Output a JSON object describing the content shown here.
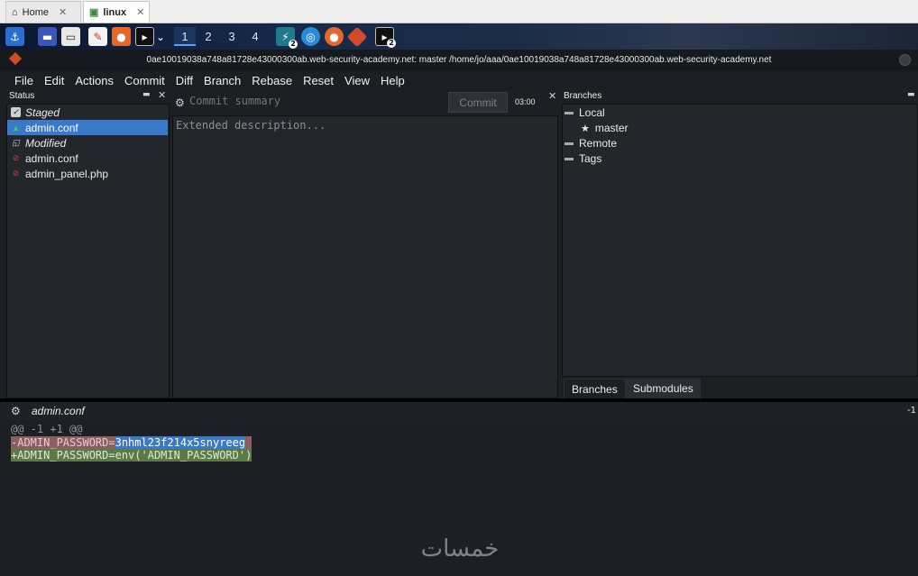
{
  "vm_tabs": [
    {
      "label": "Home",
      "icon": "home-icon"
    },
    {
      "label": "linux",
      "icon": "vm-icon",
      "active": true
    }
  ],
  "panel": {
    "workspaces": [
      "1",
      "2",
      "3",
      "4"
    ],
    "current_workspace": "1",
    "badge_a": "2",
    "badge_b": "2"
  },
  "window": {
    "title": "0ae10019038a748a81728e43000300ab.web-security-academy.net: master /home/jo/aaa/0ae10019038a748a81728e43000300ab.web-security-academy.net"
  },
  "menu": [
    "File",
    "Edit",
    "Actions",
    "Commit",
    "Diff",
    "Branch",
    "Rebase",
    "Reset",
    "View",
    "Help"
  ],
  "status": {
    "title": "Status",
    "staged_label": "Staged",
    "staged_files": [
      "admin.conf"
    ],
    "modified_label": "Modified",
    "modified_files": [
      "admin.conf",
      "admin_panel.php"
    ]
  },
  "commit": {
    "summary_placeholder": "Commit summary",
    "description_placeholder": "Extended description...",
    "commit_label": "Commit",
    "time": "03:00"
  },
  "branches": {
    "title": "Branches",
    "local_label": "Local",
    "local_branches": [
      "master"
    ],
    "remote_label": "Remote",
    "tags_label": "Tags",
    "tabs": [
      "Branches",
      "Submodules"
    ]
  },
  "diff": {
    "file": "admin.conf",
    "right_marker": "-1",
    "hunk": "@@ -1 +1 @@",
    "removed_prefix": "-ADMIN_PASSWORD=",
    "removed_value": "3nhml23f214x5snyreeg",
    "added": "+ADMIN_PASSWORD=env('ADMIN_PASSWORD')"
  },
  "watermark": "خمسات",
  "colors": {
    "selection": "#3a78c8",
    "deleted": "#8b5e62",
    "added": "#5a7a46",
    "background": "#1c1f23"
  }
}
